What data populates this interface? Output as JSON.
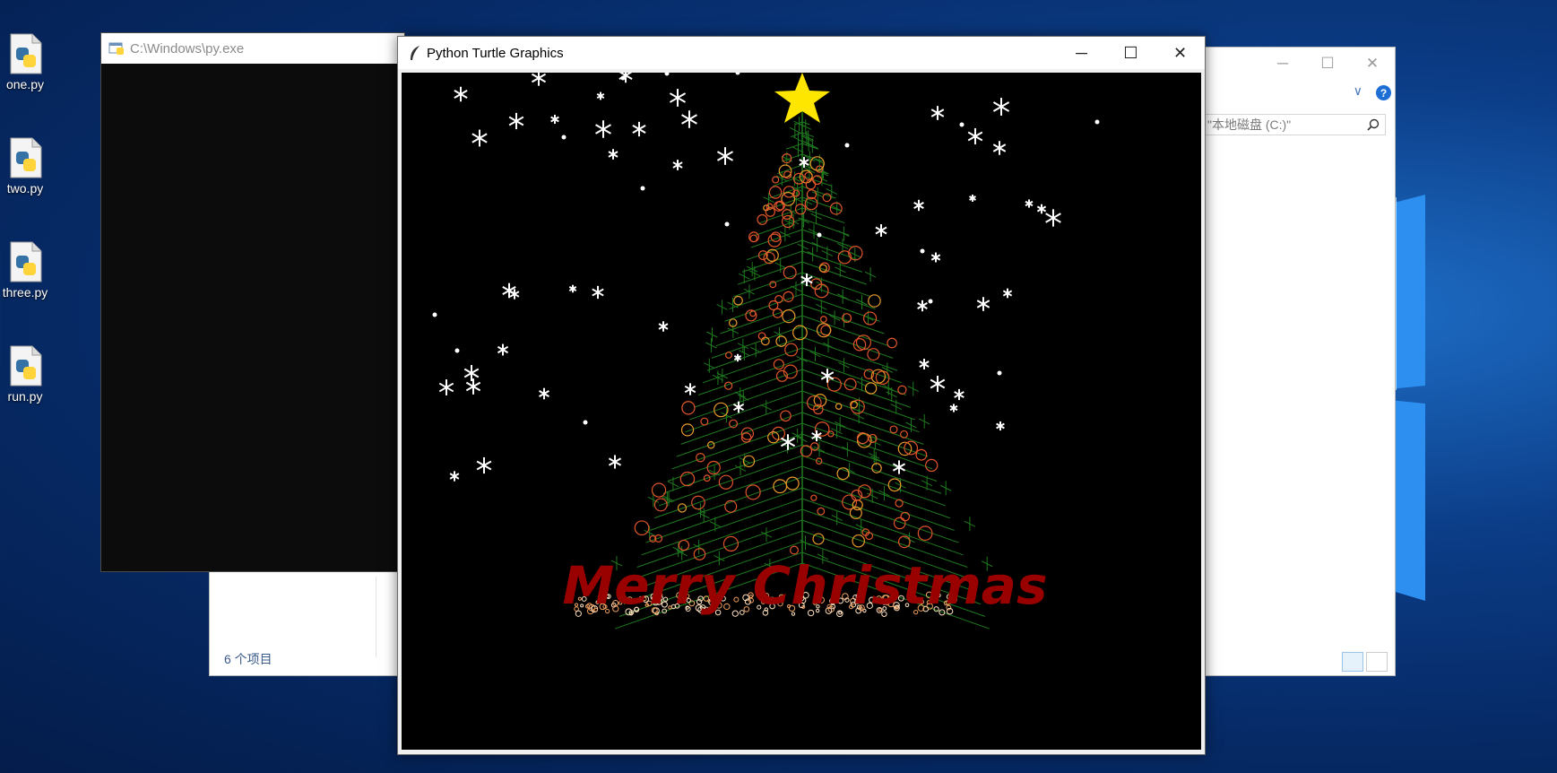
{
  "desktop": {
    "icons": [
      {
        "label": "one.py",
        "icon": "python-file-icon"
      },
      {
        "label": "two.py",
        "icon": "python-file-icon"
      },
      {
        "label": "three.py",
        "icon": "python-file-icon"
      },
      {
        "label": "run.py",
        "icon": "python-file-icon"
      }
    ]
  },
  "console": {
    "title": "C:\\Windows\\py.exe",
    "icon": "console-app-icon"
  },
  "explorer": {
    "search_placeholder": "\"本地磁盘 (C:)\"",
    "status_text": "6 个项目",
    "controls": {
      "minimize": "─",
      "maximize": "☐",
      "close": "✕"
    },
    "help_glyph": "?",
    "expand_glyph": "∨"
  },
  "turtle": {
    "title": "Python Turtle Graphics",
    "icon": "feather-icon",
    "controls": {
      "minimize": "─",
      "maximize": "☐",
      "close": "✕"
    },
    "greeting": "Merry Christmas",
    "colors": {
      "background": "#000000",
      "tree": "#1f7a1f",
      "ornament": "#e0552a",
      "star": "#ffe600",
      "text": "#990000",
      "snow": "#ffffff"
    }
  }
}
